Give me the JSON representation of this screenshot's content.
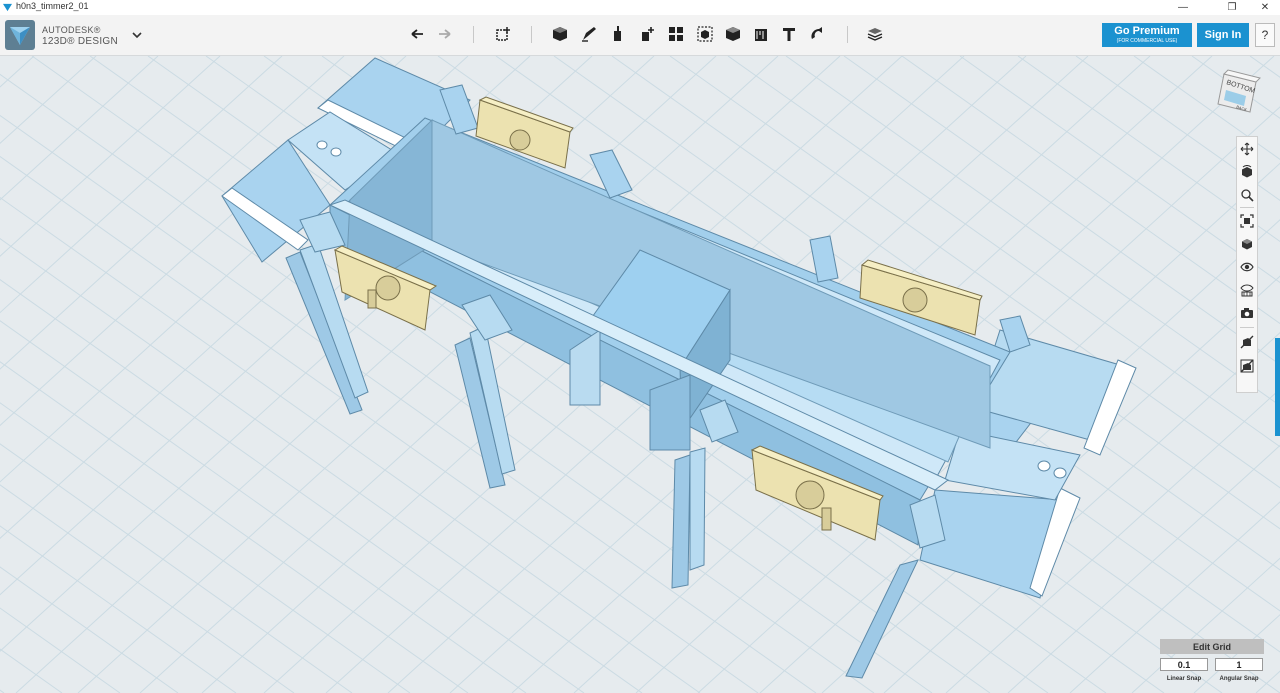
{
  "window": {
    "title": "h0n3_timmer2_01",
    "controls": [
      "minimize",
      "restore",
      "close"
    ]
  },
  "brand": {
    "line1": "AUTODESK®",
    "line2": "123D® DESIGN"
  },
  "toolbar": {
    "tools": [
      {
        "name": "undo-icon"
      },
      {
        "name": "redo-icon"
      },
      {
        "name": "transform-icon"
      },
      {
        "name": "primitives-icon"
      },
      {
        "name": "sketch-icon"
      },
      {
        "name": "construct-icon"
      },
      {
        "name": "modify-icon"
      },
      {
        "name": "pattern-icon"
      },
      {
        "name": "grouping-icon"
      },
      {
        "name": "combine-icon"
      },
      {
        "name": "measure-icon"
      },
      {
        "name": "text-icon"
      },
      {
        "name": "snap-icon"
      },
      {
        "name": "material-icon"
      }
    ]
  },
  "account": {
    "premium_label": "Go Premium",
    "premium_sub": "(FOR COMMERCIAL USE)",
    "signin_label": "Sign In",
    "help_label": "?"
  },
  "viewcube": {
    "face_top": "BOTTOM",
    "face_side": "BACK"
  },
  "navbar": {
    "items": [
      "pan-icon",
      "orbit-icon",
      "zoom-icon",
      "fit-icon",
      "view-icon",
      "visibility-icon",
      "material-view-icon",
      "screenshot-icon",
      "hide-icon",
      "hide-all-icon"
    ]
  },
  "grid_panel": {
    "title": "Edit Grid",
    "linear_snap_value": "0.1",
    "angular_snap_value": "1",
    "linear_snap_label": "Linear Snap",
    "angular_snap_label": "Angular Snap"
  },
  "colors": {
    "accent": "#1b92d0",
    "model_body": "#a9d3ef",
    "model_detail": "#f0e6b0",
    "grid_bg": "#e6ebee",
    "grid_line": "#c8d8e0"
  }
}
